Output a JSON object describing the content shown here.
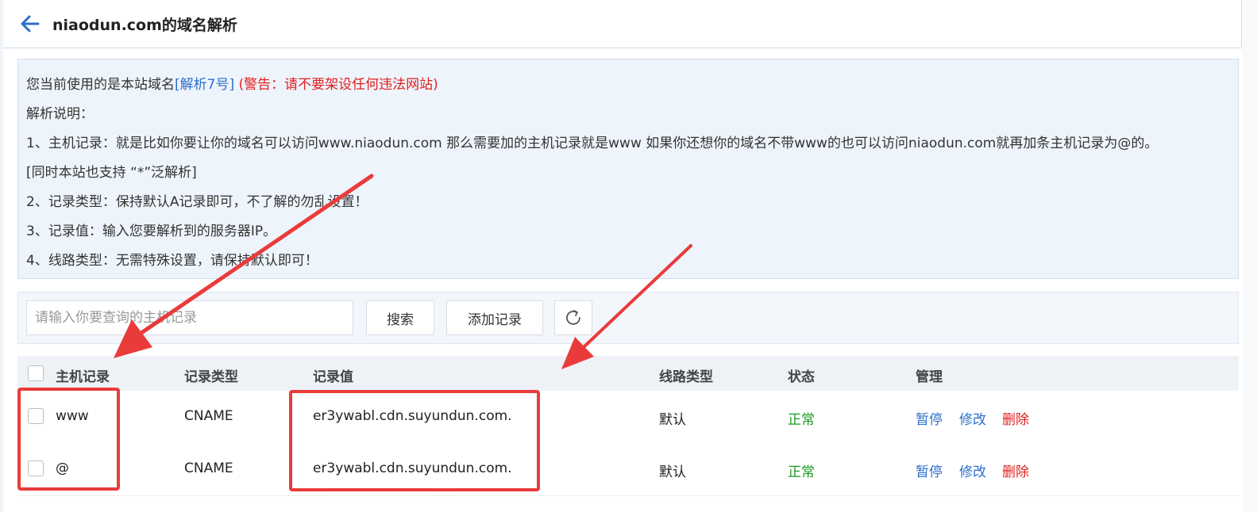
{
  "header": {
    "title": "niaodun.com的域名解析",
    "back_icon": "arrow-left-icon"
  },
  "notice": {
    "line1_prefix": "您当前使用的是本站域名",
    "line1_link": "[解析7号]",
    "line1_warning": "(警告：请不要架设任何违法网站)",
    "line2": "解析说明：",
    "line3": "1、主机记录：就是比如你要让你的域名可以访问www.niaodun.com 那么需要加的主机记录就是www 如果你还想你的域名不带www的也可以访问niaodun.com就再加条主机记录为@的。",
    "line4": "[同时本站也支持 “*”泛解析]",
    "line5": "2、记录类型：保持默认A记录即可，不了解的勿乱设置！",
    "line6": "3、记录值：输入您要解析到的服务器IP。",
    "line7": "4、线路类型：无需特殊设置，请保持默认即可！"
  },
  "toolbar": {
    "search_placeholder": "请输入你要查询的主机记录",
    "search_button": "搜索",
    "add_button": "添加记录",
    "refresh_icon": "refresh-icon"
  },
  "table": {
    "headers": [
      "主机记录",
      "记录类型",
      "记录值",
      "线路类型",
      "状态",
      "管理"
    ],
    "rows": [
      {
        "host": "www",
        "type": "CNAME",
        "value": "er3ywabl.cdn.suyundun.com.",
        "line": "默认",
        "status": "正常",
        "pause": "暂停",
        "edit": "修改",
        "delete": "删除"
      },
      {
        "host": "@",
        "type": "CNAME",
        "value": "er3ywabl.cdn.suyundun.com.",
        "line": "默认",
        "status": "正常",
        "pause": "暂停",
        "edit": "修改",
        "delete": "删除"
      }
    ]
  },
  "colors": {
    "accent": "#2c6fcb",
    "warning": "#e02020",
    "status_ok": "#1c9a22",
    "annotation": "#ea3b3b"
  }
}
